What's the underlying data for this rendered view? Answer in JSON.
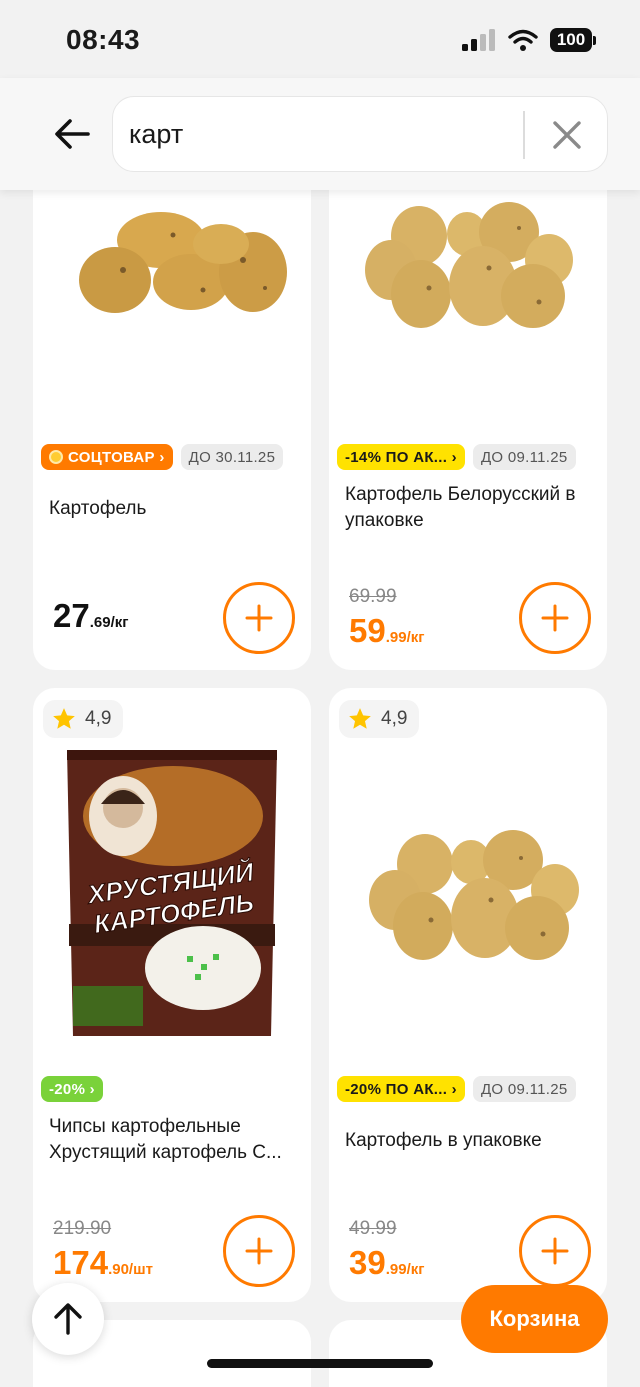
{
  "status_bar": {
    "time": "08:43",
    "battery": "100"
  },
  "search": {
    "value": "карт"
  },
  "products": [
    {
      "badges": [
        "СОЦТОВАР ›",
        "ДО 30.11.25"
      ],
      "name": "Картофель",
      "old_price": "",
      "price_main": "27",
      "price_frac": ".69",
      "price_unit": "/кг"
    },
    {
      "badges": [
        "-14% ПО АК... ›",
        "ДО 09.11.25"
      ],
      "name": "Картофель Белорусский в упаковке",
      "old_price": "69.99",
      "price_main": "59",
      "price_frac": ".99",
      "price_unit": "/кг"
    },
    {
      "rating": "4,9",
      "badges": [
        "-20% ›"
      ],
      "name": "Чипсы картофельные Хрустящий картофель С...",
      "old_price": "219.90",
      "price_main": "174",
      "price_frac": ".90",
      "price_unit": "/шт",
      "package_text": "ХРУСТЯЩИЙ КАРТОФЕЛЬ"
    },
    {
      "rating": "4,9",
      "badges": [
        "-20% ПО АК... ›",
        "ДО 09.11.25"
      ],
      "name": "Картофель в упаковке",
      "old_price": "49.99",
      "price_main": "39",
      "price_frac": ".99",
      "price_unit": "/кг"
    }
  ],
  "cart_label": "Корзина",
  "icons": {
    "back": "arrow-left-icon",
    "clear": "close-icon",
    "add": "plus-icon",
    "rating": "star-icon",
    "scroll_top": "arrow-up-icon"
  },
  "colors": {
    "accent": "#ff7a00",
    "promo_yellow": "#ffe200",
    "promo_green": "#7ad23a",
    "star": "#ffc400"
  }
}
